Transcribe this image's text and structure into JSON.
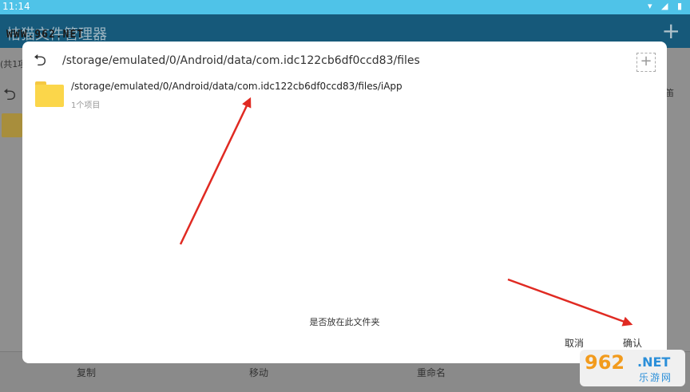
{
  "status": {
    "time": "11:14",
    "icons": "▾ ◢ ▮"
  },
  "app": {
    "title": "桔猫文件管理器",
    "add_glyph": "+",
    "watermark": "WWW.962.NET"
  },
  "background": {
    "count_text": "(共1项",
    "side_text": "笛"
  },
  "bottombar": {
    "copy": "复制",
    "move": "移动",
    "rename": "重命名"
  },
  "dialog": {
    "current_path": "/storage/emulated/0/Android/data/com.idc122cb6df0ccd83/files",
    "items": [
      {
        "name": "/storage/emulated/0/Android/data/com.idc122cb6df0ccd83/files/iApp",
        "sub": "1个项目"
      }
    ],
    "question": "是否放在此文件夹",
    "cancel_label": "取消",
    "ok_label": "确认"
  },
  "logo": {
    "num": "962",
    "net": ".NET",
    "cn": "乐游网"
  },
  "colors": {
    "statusbar": "#4fc3e8",
    "appbar": "#16597a",
    "folder": "#fbd64a",
    "arrow": "#e02a22"
  }
}
